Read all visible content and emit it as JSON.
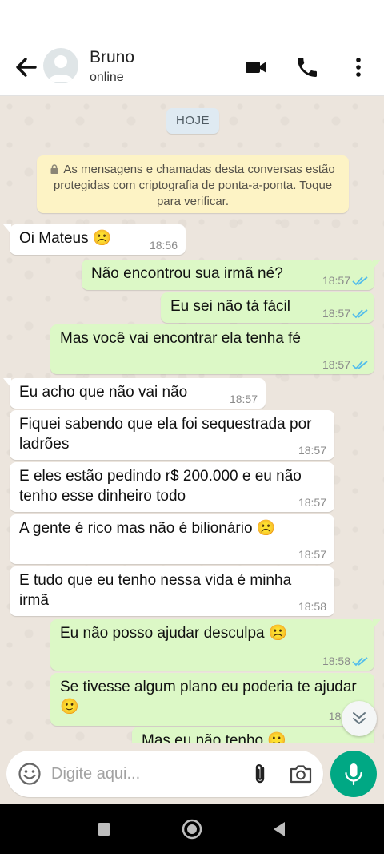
{
  "header": {
    "contact_name": "Bruno",
    "contact_status": "online",
    "icons": [
      "back-arrow-icon",
      "avatar-icon",
      "video-call-icon",
      "phone-icon",
      "more-vert-icon"
    ]
  },
  "chat": {
    "date_label": "HOJE",
    "encryption_notice": "As mensagens e chamadas desta conversas estão protegidas com criptografia de ponta-a-ponta. Toque para verificar.",
    "messages": [
      {
        "direction": "in",
        "text": "Oi Mateus ☹️",
        "time": "18:56"
      },
      {
        "direction": "out",
        "text": "Não encontrou sua irmã né?",
        "time": "18:57",
        "status": "read"
      },
      {
        "direction": "out",
        "text": "Eu sei não tá fácil",
        "time": "18:57",
        "status": "read"
      },
      {
        "direction": "out",
        "text": "Mas você vai encontrar ela tenha fé",
        "time": "18:57",
        "status": "read"
      },
      {
        "direction": "in",
        "text": "Eu acho que não vai não",
        "time": "18:57"
      },
      {
        "direction": "in",
        "text": "Fiquei sabendo que ela foi sequestrada por ladrões",
        "time": "18:57"
      },
      {
        "direction": "in",
        "text": "E eles estão pedindo r$ 200.000 e eu não tenho esse dinheiro todo",
        "time": "18:57"
      },
      {
        "direction": "in",
        "text": "A gente é rico mas não é bilionário ☹️",
        "time": "18:57"
      },
      {
        "direction": "in",
        "text": "E tudo que eu tenho nessa vida é minha irmã",
        "time": "18:58"
      },
      {
        "direction": "out",
        "text": "Eu não posso ajudar desculpa ☹️",
        "time": "18:58",
        "status": "read"
      },
      {
        "direction": "out",
        "text": "Se tivesse algum plano eu poderia te ajudar 🙂",
        "time": "18:5",
        "status": "read"
      },
      {
        "direction": "out",
        "text": "Mas eu não tenho 🙂",
        "time": "",
        "status": "read"
      }
    ]
  },
  "composer": {
    "placeholder": "Digite aqui...",
    "icons": [
      "emoji-icon",
      "attach-icon",
      "camera-icon",
      "mic-icon"
    ]
  },
  "colors": {
    "accent": "#00a884",
    "outgoing_bubble": "#dcf8c6",
    "incoming_bubble": "#ffffff",
    "chat_background": "#ece5dd",
    "read_ticks": "#53bdeb",
    "notice_background": "#fdf3c5"
  }
}
